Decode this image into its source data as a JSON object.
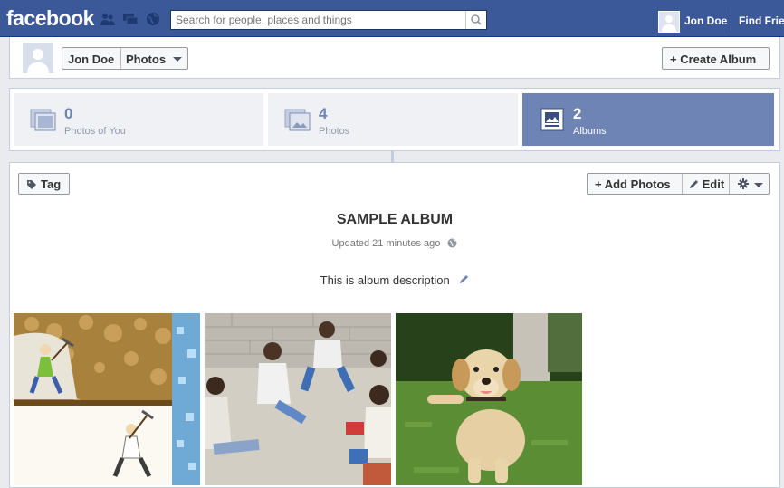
{
  "topbar": {
    "logo": "facebook",
    "search_placeholder": "Search for people, places and things",
    "user_name": "Jon Doe",
    "find_friends": "Find Friends"
  },
  "header": {
    "crumb_name": "Jon Doe",
    "crumb_section": "Photos",
    "create_album": "+ Create Album"
  },
  "stats": [
    {
      "count": "0",
      "label": "Photos of You"
    },
    {
      "count": "4",
      "label": "Photos"
    },
    {
      "count": "2",
      "label": "Albums"
    }
  ],
  "album": {
    "tag_label": "Tag",
    "add_photos": "+ Add Photos",
    "edit_label": "Edit",
    "title": "SAMPLE ALBUM",
    "updated": "Updated 21 minutes ago",
    "description": "This is album description"
  },
  "colors": {
    "brand": "#3b5998",
    "active_tile": "#6d84b4"
  }
}
